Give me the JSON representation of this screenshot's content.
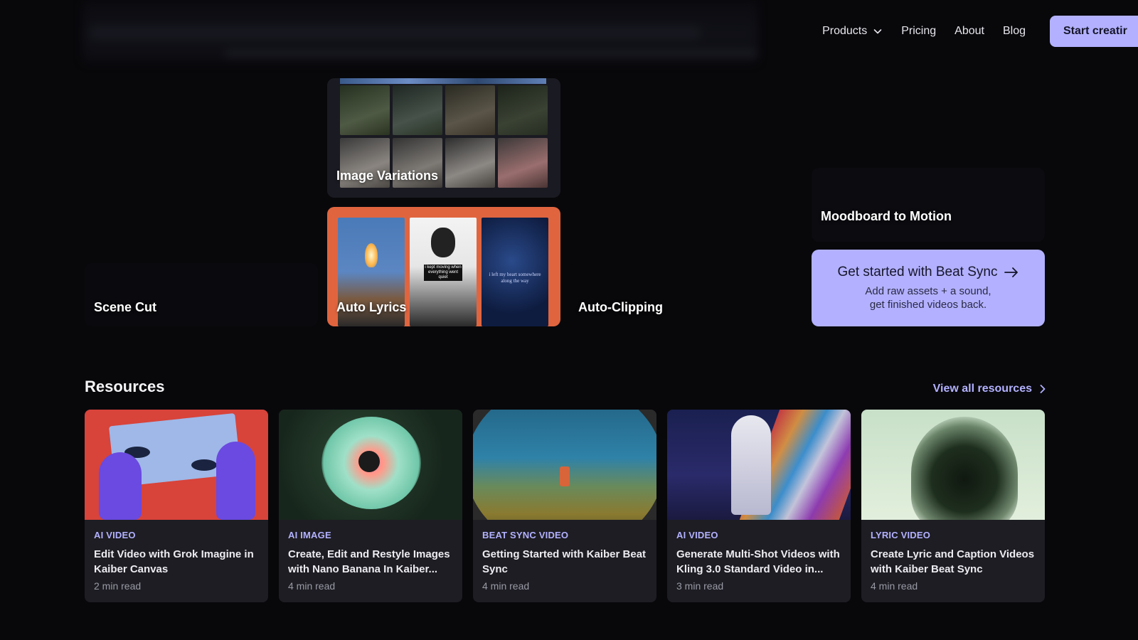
{
  "nav": {
    "items": [
      {
        "label": "Products",
        "has_dropdown": true
      },
      {
        "label": "Pricing"
      },
      {
        "label": "About"
      },
      {
        "label": "Blog"
      }
    ],
    "cta_label": "Start creatir"
  },
  "features": {
    "image_variations": "Image Variations",
    "moodboard": "Moodboard to Motion",
    "scene_cut": "Scene Cut",
    "auto_lyrics": "Auto Lyrics",
    "auto_clipping": "Auto-Clipping",
    "lyric_caption_1": "i kept moving when everything went quiet",
    "lyric_caption_2": "i left my heart somewhere along the way"
  },
  "beat_sync_cta": {
    "title": "Get started with Beat Sync",
    "line1": "Add raw assets + a sound,",
    "line2": "get finished videos back."
  },
  "resources": {
    "title": "Resources",
    "view_all": "View all resources",
    "cards": [
      {
        "category": "AI VIDEO",
        "title": "Edit Video with Grok Imagine in Kaiber Canvas",
        "read": "2 min read"
      },
      {
        "category": "AI IMAGE",
        "title": "Create, Edit and Restyle Images with Nano Banana In Kaiber...",
        "read": "4 min read"
      },
      {
        "category": "BEAT SYNC VIDEO",
        "title": "Getting Started with Kaiber Beat Sync",
        "read": "4 min read"
      },
      {
        "category": "AI VIDEO",
        "title": "Generate Multi-Shot Videos with Kling 3.0 Standard Video in...",
        "read": "3 min read"
      },
      {
        "category": "LYRIC VIDEO",
        "title": "Create Lyric and Caption Videos with Kaiber Beat Sync",
        "read": "4 min read"
      }
    ]
  },
  "colors": {
    "accent": "#b3b1ff",
    "background": "#08080b",
    "card": "#1d1d23",
    "lyrics_tile": "#e0653f"
  }
}
